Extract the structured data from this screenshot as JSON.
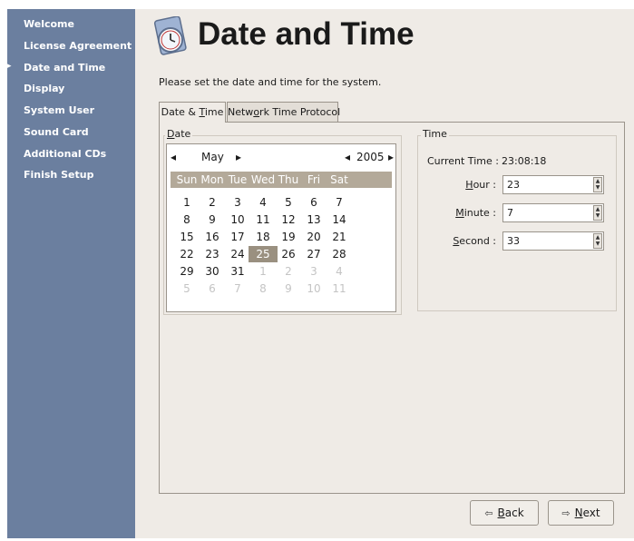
{
  "sidebar": {
    "items": [
      {
        "label": "Welcome",
        "current": false
      },
      {
        "label": "License Agreement",
        "current": false
      },
      {
        "label": "Date and Time",
        "current": true,
        "marker": "▸"
      },
      {
        "label": "Display",
        "current": false
      },
      {
        "label": "System User",
        "current": false
      },
      {
        "label": "Sound Card",
        "current": false
      },
      {
        "label": "Additional CDs",
        "current": false
      },
      {
        "label": "Finish Setup",
        "current": false
      }
    ]
  },
  "header": {
    "title": "Date and Time",
    "icon": "clock-icon"
  },
  "description": "Please set the date and time for the system.",
  "tabs": [
    {
      "label_pre": "Date & ",
      "label_mn": "T",
      "label_post": "ime",
      "active": true
    },
    {
      "label_pre": "Netw",
      "label_mn": "o",
      "label_post": "rk Time Protocol",
      "active": false
    }
  ],
  "date_section": {
    "label_mn": "D",
    "label_post": "ate",
    "month": "May",
    "year": "2005",
    "prev_symbol": "◂",
    "next_symbol": "▸",
    "weekdays": [
      "Sun",
      "Mon",
      "Tue",
      "Wed",
      "Thu",
      "Fri",
      "Sat"
    ],
    "weeks": [
      [
        {
          "d": "1"
        },
        {
          "d": "2"
        },
        {
          "d": "3"
        },
        {
          "d": "4"
        },
        {
          "d": "5"
        },
        {
          "d": "6"
        },
        {
          "d": "7"
        }
      ],
      [
        {
          "d": "8"
        },
        {
          "d": "9"
        },
        {
          "d": "10"
        },
        {
          "d": "11"
        },
        {
          "d": "12"
        },
        {
          "d": "13"
        },
        {
          "d": "14"
        }
      ],
      [
        {
          "d": "15"
        },
        {
          "d": "16"
        },
        {
          "d": "17"
        },
        {
          "d": "18"
        },
        {
          "d": "19"
        },
        {
          "d": "20"
        },
        {
          "d": "21"
        }
      ],
      [
        {
          "d": "22"
        },
        {
          "d": "23"
        },
        {
          "d": "24"
        },
        {
          "d": "25",
          "sel": true
        },
        {
          "d": "26"
        },
        {
          "d": "27"
        },
        {
          "d": "28"
        }
      ],
      [
        {
          "d": "29"
        },
        {
          "d": "30"
        },
        {
          "d": "31"
        },
        {
          "d": "1",
          "other": true
        },
        {
          "d": "2",
          "other": true
        },
        {
          "d": "3",
          "other": true
        },
        {
          "d": "4",
          "other": true
        }
      ],
      [
        {
          "d": "5",
          "other": true
        },
        {
          "d": "6",
          "other": true
        },
        {
          "d": "7",
          "other": true
        },
        {
          "d": "8",
          "other": true
        },
        {
          "d": "9",
          "other": true
        },
        {
          "d": "10",
          "other": true
        },
        {
          "d": "11",
          "other": true
        }
      ]
    ]
  },
  "time_section": {
    "label": "Time",
    "current_time_label": "Current Time :",
    "current_time_value": "23:08:18",
    "fields": [
      {
        "mn": "H",
        "rest": "our :",
        "value": "23"
      },
      {
        "mn": "M",
        "rest": "inute :",
        "value": "7"
      },
      {
        "mn": "S",
        "rest": "econd :",
        "value": "33"
      }
    ]
  },
  "buttons": {
    "back_mn": "B",
    "back_rest": "ack",
    "back_icon": "back-arrow-icon",
    "next_mn": "N",
    "next_rest": "ext",
    "next_icon": "next-arrow-icon"
  },
  "colors": {
    "sidebar": "#6b7f9f",
    "panel": "#efebe6",
    "calendar_header": "#b3a999",
    "selected_day": "#9a9080"
  }
}
